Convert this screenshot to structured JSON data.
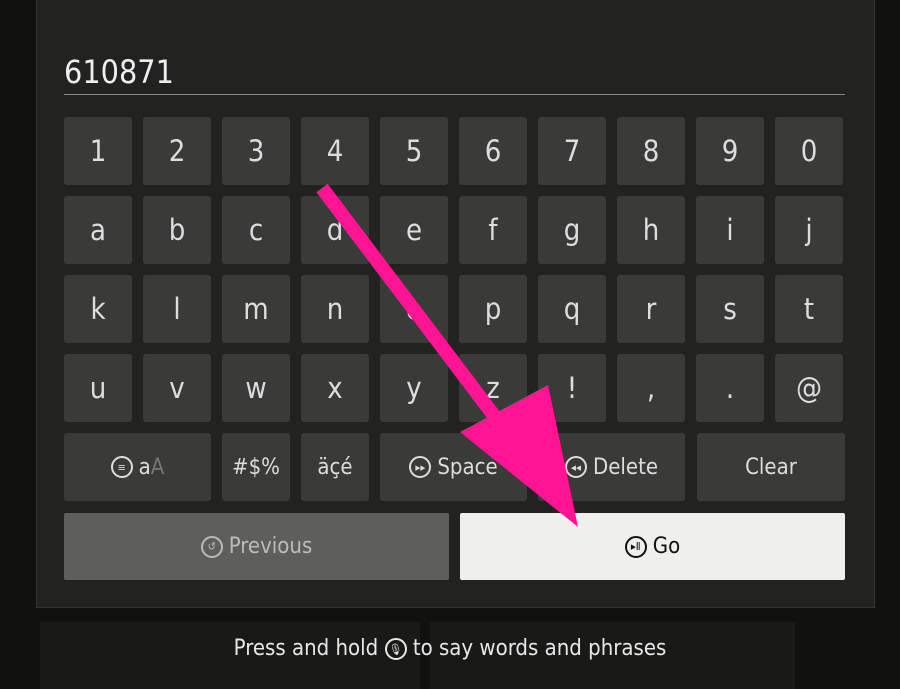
{
  "input": {
    "value": "610871"
  },
  "rows": [
    [
      "1",
      "2",
      "3",
      "4",
      "5",
      "6",
      "7",
      "8",
      "9",
      "0"
    ],
    [
      "a",
      "b",
      "c",
      "d",
      "e",
      "f",
      "g",
      "h",
      "i",
      "j"
    ],
    [
      "k",
      "l",
      "m",
      "n",
      "o",
      "p",
      "q",
      "r",
      "s",
      "t"
    ],
    [
      "u",
      "v",
      "w",
      "x",
      "y",
      "z",
      "!",
      ",",
      ".",
      "@"
    ]
  ],
  "special": {
    "case_lower": "a",
    "case_upper": "A",
    "symbols": "#$%",
    "accents": "äçé",
    "space": "Space",
    "delete": "Delete",
    "clear": "Clear"
  },
  "buttons": {
    "previous": "Previous",
    "go": "Go"
  },
  "hint": {
    "before": "Press and hold",
    "after": "to say words and phrases"
  },
  "colors": {
    "arrow": "#ff1493",
    "go_bg": "#efefed"
  }
}
